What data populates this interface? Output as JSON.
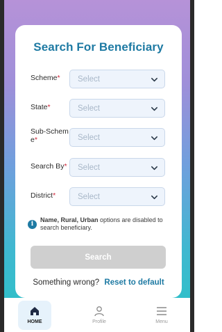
{
  "form": {
    "title": "Search For Beneficiary",
    "fields": [
      {
        "label": "Scheme",
        "required": "*",
        "placeholder": "Select"
      },
      {
        "label": "State",
        "required": "*",
        "placeholder": "Select"
      },
      {
        "label": "Sub-Schem e",
        "required": "*",
        "placeholder": "Select"
      },
      {
        "label": "Search By",
        "required": "*",
        "placeholder": "Select"
      },
      {
        "label": "District",
        "required": "*",
        "placeholder": "Select"
      }
    ],
    "info_bold": "Name, Rural, Urban",
    "info_rest": " options are disabled to search beneficiary.",
    "search_label": "Search",
    "wrong_text": "Something wrong?",
    "reset_label": "Reset to default"
  },
  "nav": {
    "home": "HOME",
    "profile": "Profile",
    "menu": "Menu"
  },
  "colors": {
    "accent": "#1e7aa3",
    "required": "#d0263a",
    "disabled_button": "#cfcfcf"
  },
  "icons": {
    "chevron": "chevron-down-icon",
    "info": "info-icon",
    "home": "home-icon",
    "profile": "user-icon",
    "menu": "hamburger-icon"
  }
}
